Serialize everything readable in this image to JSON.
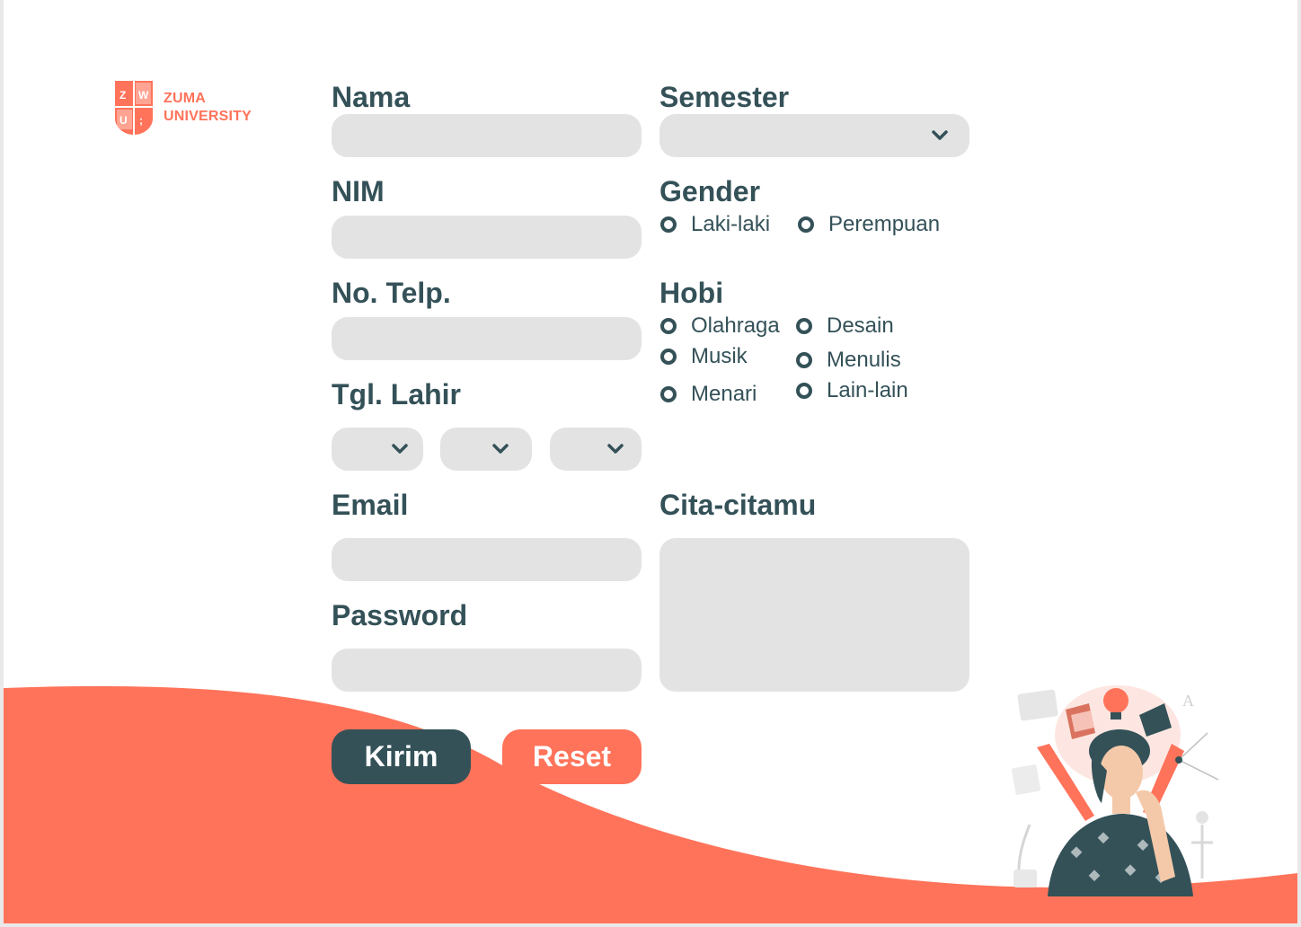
{
  "brand": {
    "line1": "ZUMA",
    "line2": "UNIVERSITY",
    "badge_letters": [
      "Z",
      "W",
      "U",
      ";"
    ]
  },
  "form": {
    "nama": {
      "label": "Nama",
      "value": "",
      "placeholder": ""
    },
    "nim": {
      "label": "NIM",
      "value": "",
      "placeholder": ""
    },
    "telp": {
      "label": "No. Telp.",
      "value": "",
      "placeholder": ""
    },
    "tgl_lahir": {
      "label": "Tgl. Lahir",
      "day": "",
      "month": "",
      "year": ""
    },
    "email": {
      "label": "Email",
      "value": "",
      "placeholder": ""
    },
    "password": {
      "label": "Password",
      "value": "",
      "placeholder": ""
    },
    "semester": {
      "label": "Semester",
      "value": ""
    },
    "gender": {
      "label": "Gender",
      "options": [
        "Laki-laki",
        "Perempuan"
      ]
    },
    "hobi": {
      "label": "Hobi",
      "options": [
        "Olahraga",
        "Desain",
        "Musik",
        "Menulis",
        "Menari",
        "Lain-lain"
      ]
    },
    "cita": {
      "label": "Cita-citamu",
      "value": ""
    }
  },
  "buttons": {
    "submit": "Kirim",
    "reset": "Reset"
  },
  "icons": {
    "dropdown": "chevron-down-icon",
    "radio": "radio-icon"
  },
  "colors": {
    "primary": "#345158",
    "accent": "#ff735a",
    "field": "#e3e3e3",
    "background": "#ffffff"
  }
}
